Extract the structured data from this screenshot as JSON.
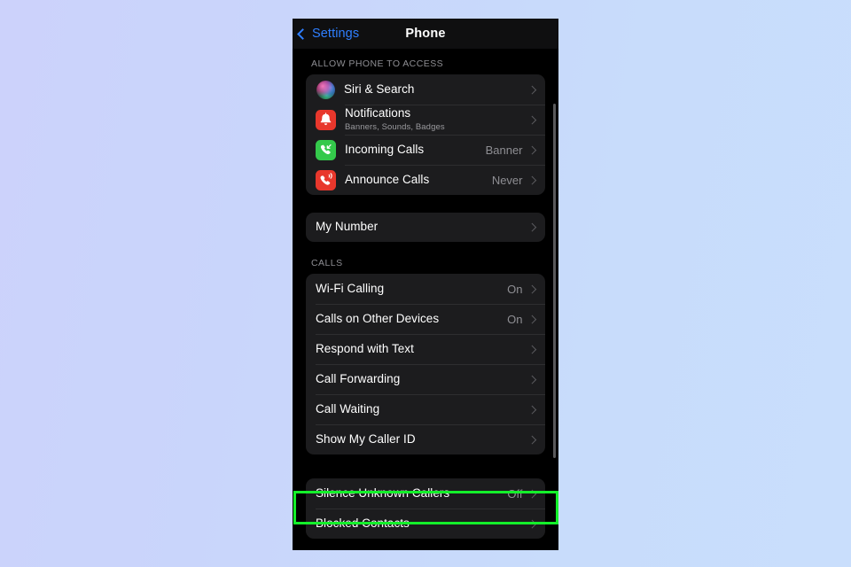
{
  "nav": {
    "back_label": "Settings",
    "title": "Phone",
    "back_icon": "chevron-left-icon",
    "back_color": "#2f7fff"
  },
  "sections": [
    {
      "header": "ALLOW PHONE TO ACCESS",
      "rows": [
        {
          "label": "Siri & Search",
          "sub": "",
          "value": "",
          "icon": "siri-icon"
        },
        {
          "label": "Notifications",
          "sub": "Banners, Sounds, Badges",
          "value": "",
          "icon": "bell-icon"
        },
        {
          "label": "Incoming Calls",
          "sub": "",
          "value": "Banner",
          "icon": "incoming-call-icon"
        },
        {
          "label": "Announce Calls",
          "sub": "",
          "value": "Never",
          "icon": "announce-call-icon"
        }
      ]
    },
    {
      "header": "",
      "rows": [
        {
          "label": "My Number",
          "sub": "",
          "value": "",
          "icon": ""
        }
      ]
    },
    {
      "header": "CALLS",
      "rows": [
        {
          "label": "Wi-Fi Calling",
          "sub": "",
          "value": "On",
          "icon": ""
        },
        {
          "label": "Calls on Other Devices",
          "sub": "",
          "value": "On",
          "icon": ""
        },
        {
          "label": "Respond with Text",
          "sub": "",
          "value": "",
          "icon": ""
        },
        {
          "label": "Call Forwarding",
          "sub": "",
          "value": "",
          "icon": ""
        },
        {
          "label": "Call Waiting",
          "sub": "",
          "value": "",
          "icon": ""
        },
        {
          "label": "Show My Caller ID",
          "sub": "",
          "value": "",
          "icon": ""
        }
      ]
    },
    {
      "header": "",
      "rows": [
        {
          "label": "Silence Unknown Callers",
          "sub": "",
          "value": "Off",
          "icon": ""
        },
        {
          "label": "Blocked Contacts",
          "sub": "",
          "value": "",
          "icon": ""
        }
      ]
    }
  ],
  "highlight": {
    "target_label": "Silence Unknown Callers",
    "color": "#14f02a"
  },
  "scrollbar": {
    "visible": true
  },
  "colors": {
    "background_left": "#ccd2fb",
    "background_right": "#c9defc",
    "screen_bg": "#000000",
    "card_bg": "#1c1c1e",
    "accent_blue": "#2f7fff",
    "secondary_text": "#8e8e93"
  }
}
